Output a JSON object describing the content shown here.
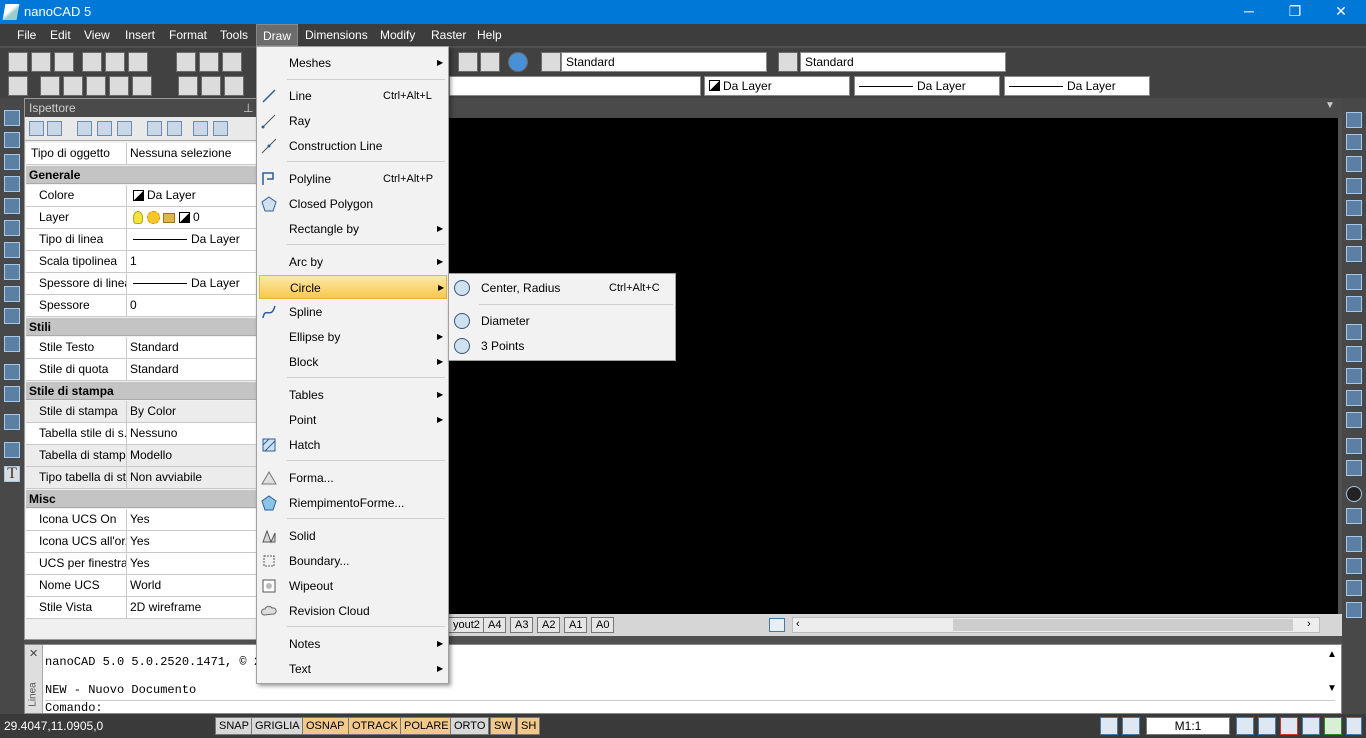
{
  "window": {
    "title": "nanoCAD 5",
    "minimize": "─",
    "restore": "❐",
    "close": "✕"
  },
  "menubar": [
    "File",
    "Edit",
    "View",
    "Insert",
    "Format",
    "Tools",
    "Draw",
    "Dimensions",
    "Modify",
    "Raster",
    "Help"
  ],
  "toolbar": {
    "text_style": "Standard",
    "dim_style": "Standard",
    "color": "Da Layer",
    "linetype": "Da Layer",
    "lineweight": "Da Layer"
  },
  "inspector": {
    "title": "Ispettore",
    "pin": "⊥",
    "object_type_key": "Tipo di oggetto",
    "object_type_val": "Nessuna selezione",
    "cats": {
      "general": "Generale",
      "styles": "Stili",
      "print_style": "Stile di stampa",
      "misc": "Misc"
    },
    "general": [
      {
        "k": "Colore",
        "v": "Da Layer"
      },
      {
        "k": "Layer",
        "v": "0"
      },
      {
        "k": "Tipo di linea",
        "v": "Da Layer"
      },
      {
        "k": "Scala tipolinea",
        "v": "1"
      },
      {
        "k": "Spessore di linea",
        "v": "Da Layer"
      },
      {
        "k": "Spessore",
        "v": "0"
      }
    ],
    "styles": [
      {
        "k": "Stile Testo",
        "v": "Standard"
      },
      {
        "k": "Stile di quota",
        "v": "Standard"
      }
    ],
    "print_style": [
      {
        "k": "Stile di stampa",
        "v": "By Color"
      },
      {
        "k": "Tabella stile di s...",
        "v": "Nessuno"
      },
      {
        "k": "Tabella di stamp...",
        "v": "Modello"
      },
      {
        "k": "Tipo tabella di st...",
        "v": "Non avviabile"
      }
    ],
    "misc": [
      {
        "k": "Icona UCS On",
        "v": "Yes"
      },
      {
        "k": "Icona UCS all'or...",
        "v": "Yes"
      },
      {
        "k": "UCS per finestra",
        "v": "Yes"
      },
      {
        "k": "Nome UCS",
        "v": "World"
      },
      {
        "k": "Stile Vista",
        "v": "2D wireframe"
      }
    ]
  },
  "draw_menu": {
    "meshes": "Meshes",
    "line": "Line",
    "line_sc": "Ctrl+Alt+L",
    "ray": "Ray",
    "construction_line": "Construction Line",
    "polyline": "Polyline",
    "polyline_sc": "Ctrl+Alt+P",
    "closed_polygon": "Closed Polygon",
    "rectangle_by": "Rectangle by",
    "arc_by": "Arc by",
    "circle": "Circle",
    "spline": "Spline",
    "ellipse_by": "Ellipse by",
    "block": "Block",
    "tables": "Tables",
    "point": "Point",
    "hatch": "Hatch",
    "forma": "Forma...",
    "riempimento": "RiempimentoForme...",
    "solid": "Solid",
    "boundary": "Boundary...",
    "wipeout": "Wipeout",
    "revision_cloud": "Revision Cloud",
    "notes": "Notes",
    "text": "Text",
    "arrow": "▶"
  },
  "circle_menu": {
    "center_radius": "Center, Radius",
    "center_radius_sc": "Ctrl+Alt+C",
    "diameter": "Diameter",
    "three_points": "3 Points"
  },
  "layout_tabs": [
    "yout2",
    "A4",
    "A3",
    "A2",
    "A1",
    "A0"
  ],
  "command": {
    "line1": "nanoCAD 5.0 5.0.2520.1471, © 2",
    "line2": "NEW - Nuovo Documento",
    "prompt": "Comando:",
    "side_label": "Linea"
  },
  "status": {
    "coords": "29.4047,11.0905,0",
    "buttons": [
      {
        "label": "SNAP",
        "on": false
      },
      {
        "label": "GRIGLIA",
        "on": false
      },
      {
        "label": "OSNAP",
        "on": true
      },
      {
        "label": "OTRACK",
        "on": true
      },
      {
        "label": "POLARE",
        "on": true
      },
      {
        "label": "ORTO",
        "on": false
      },
      {
        "label": "SW",
        "on": true
      },
      {
        "label": "SH",
        "on": true
      }
    ],
    "scale": "M1:1"
  }
}
